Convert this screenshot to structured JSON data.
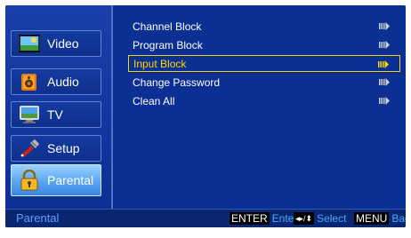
{
  "menu": {
    "items": [
      {
        "label": "Video",
        "icon": "video-icon"
      },
      {
        "label": "Audio",
        "icon": "audio-icon"
      },
      {
        "label": "TV",
        "icon": "tv-icon"
      },
      {
        "label": "Setup",
        "icon": "setup-icon"
      },
      {
        "label": "Parental",
        "icon": "parental-lock-icon",
        "active": true
      }
    ]
  },
  "list": {
    "items": [
      {
        "label": "Channel Block"
      },
      {
        "label": "Program Block"
      },
      {
        "label": "Input Block",
        "selected": true
      },
      {
        "label": "Change Password"
      },
      {
        "label": "Clean All"
      }
    ]
  },
  "footer": {
    "title": "Parental",
    "enter_key": "ENTER",
    "enter_label": "Enter",
    "nav_label": "Select",
    "menu_key": "MENU",
    "menu_label": "Back"
  },
  "colors": {
    "background": "#0b2f93",
    "highlight": "#ffd600",
    "active_menu": "#5aa6f2",
    "hint_text": "#4aa7ff"
  }
}
